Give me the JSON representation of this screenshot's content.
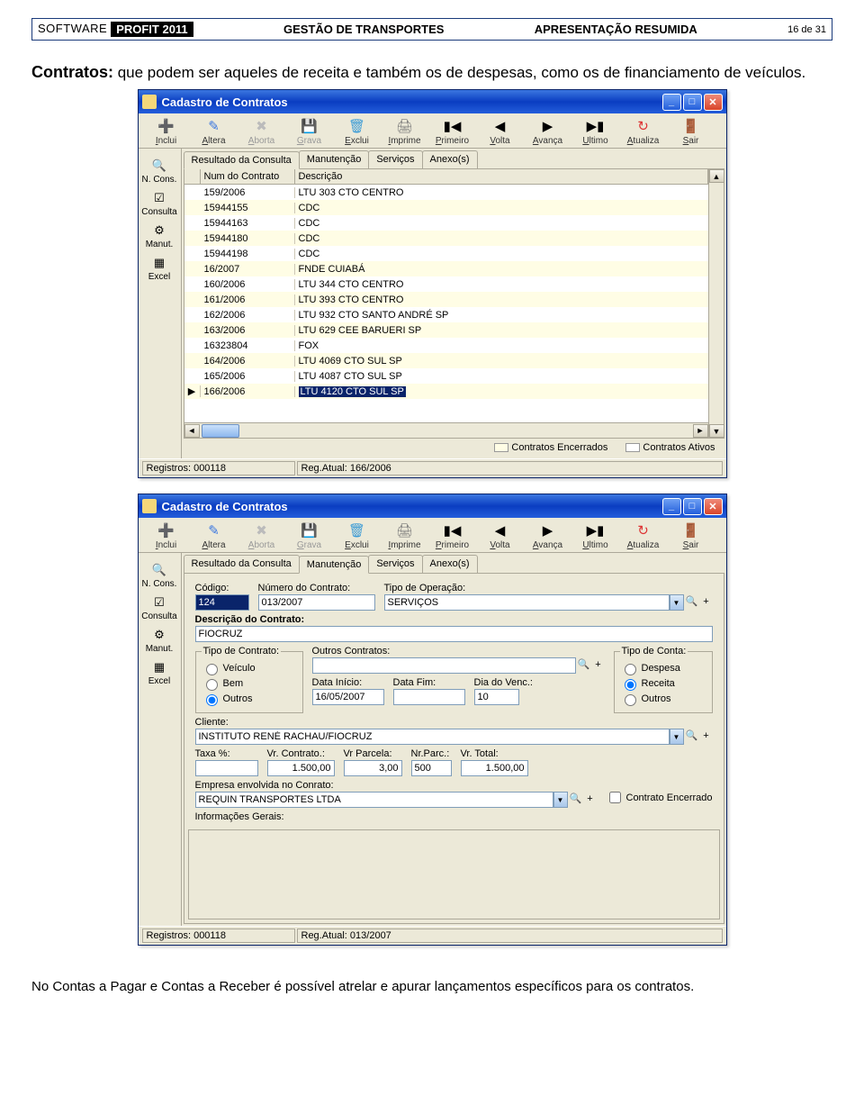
{
  "header": {
    "software": "SOFTWARE",
    "profit": "PROFIT 2011",
    "mid": "GESTÃO DE TRANSPORTES",
    "right": "APRESENTAÇÃO RESUMIDA",
    "page": "16 de 31"
  },
  "intro_bold": "Contratos:",
  "intro_text": " que podem ser aqueles de receita e também os de despesas, como os de financiamento de veículos.",
  "footer_text": "No Contas a Pagar e Contas a Receber é possível atrelar e apurar lançamentos específicos para os contratos.",
  "win": {
    "title": "Cadastro de Contratos",
    "toolbar": [
      {
        "label": "Inclui",
        "icon": "➕",
        "color": "#2a9d2a"
      },
      {
        "label": "Altera",
        "icon": "✎",
        "color": "#3b77e0"
      },
      {
        "label": "Aborta",
        "icon": "✖",
        "color": "#bbb",
        "dis": true
      },
      {
        "label": "Grava",
        "icon": "💾",
        "color": "#bbb",
        "dis": true
      },
      {
        "label": "Exclui",
        "icon": "🗑",
        "color": "#3b9bd6"
      },
      {
        "label": "Imprime",
        "icon": "🖨",
        "color": "#777"
      },
      {
        "label": "Primeiro",
        "icon": "▮◀",
        "color": "#000"
      },
      {
        "label": "Volta",
        "icon": "◀",
        "color": "#000"
      },
      {
        "label": "Avança",
        "icon": "▶",
        "color": "#000"
      },
      {
        "label": "Ultimo",
        "icon": "▶▮",
        "color": "#000"
      },
      {
        "label": "Atualiza",
        "icon": "↻",
        "color": "#d33"
      },
      {
        "label": "Sair",
        "icon": "🚪",
        "color": "#2a9d2a"
      }
    ],
    "sidebar": [
      {
        "label": "N. Cons.",
        "icon": "🔍"
      },
      {
        "label": "Consulta",
        "icon": "☑"
      },
      {
        "label": "Manut.",
        "icon": "⚙"
      },
      {
        "label": "Excel",
        "icon": "▦"
      }
    ],
    "tabs1": [
      "Resultado da Consulta",
      "Manutenção",
      "Serviços",
      "Anexo(s)"
    ],
    "grid": {
      "col1": "Num do Contrato",
      "col2": "Descrição",
      "rows": [
        {
          "n": "159/2006",
          "d": "LTU 303 CTO CENTRO"
        },
        {
          "n": "15944155",
          "d": "CDC"
        },
        {
          "n": "15944163",
          "d": "CDC"
        },
        {
          "n": "15944180",
          "d": "CDC"
        },
        {
          "n": "15944198",
          "d": "CDC"
        },
        {
          "n": "16/2007",
          "d": "FNDE CUIABÁ"
        },
        {
          "n": "160/2006",
          "d": "LTU 344 CTO CENTRO"
        },
        {
          "n": "161/2006",
          "d": "LTU 393 CTO CENTRO"
        },
        {
          "n": "162/2006",
          "d": "LTU 932 CTO SANTO ANDRÉ SP"
        },
        {
          "n": "163/2006",
          "d": "LTU 629 CEE BARUERI SP"
        },
        {
          "n": "16323804",
          "d": "FOX"
        },
        {
          "n": "164/2006",
          "d": "LTU 4069 CTO SUL SP"
        },
        {
          "n": "165/2006",
          "d": "LTU 4087 CTO SUL SP"
        },
        {
          "n": "166/2006",
          "d": "LTU 4120 CTO SUL SP"
        }
      ],
      "sel_index": 13
    },
    "legend": {
      "enc": "Contratos Encerrados",
      "ativ": "Contratos Ativos"
    },
    "status1": {
      "reg": "Registros: 000118",
      "atual": "Reg.Atual: 166/2006"
    }
  },
  "form": {
    "codigo_lbl": "Código:",
    "codigo": "124",
    "num_lbl": "Número do Contrato:",
    "num": "013/2007",
    "tipo_op_lbl": "Tipo de Operação:",
    "tipo_op": "SERVIÇOS",
    "desc_lbl": "Descrição do Contrato:",
    "desc": "FIOCRUZ",
    "tc_legend": "Tipo de Contrato:",
    "tc_opts": [
      "Veículo",
      "Bem",
      "Outros"
    ],
    "tc_sel": 2,
    "outros_lbl": "Outros Contratos:",
    "di_lbl": "Data Início:",
    "di": "16/05/2007",
    "df_lbl": "Data Fim:",
    "df": "",
    "dv_lbl": "Dia do Venc.:",
    "dv": "10",
    "tconta_legend": "Tipo de Conta:",
    "tconta_opts": [
      "Despesa",
      "Receita",
      "Outros"
    ],
    "tconta_sel": 1,
    "cli_lbl": "Cliente:",
    "cli": "INSTITUTO RENÉ RACHAU/FIOCRUZ",
    "taxa_lbl": "Taxa %:",
    "taxa": "",
    "vrc_lbl": "Vr. Contrato.:",
    "vrc": "1.500,00",
    "vrp_lbl": "Vr Parcela:",
    "vrp": "3,00",
    "np_lbl": "Nr.Parc.:",
    "np": "500",
    "vrt_lbl": "Vr. Total:",
    "vrt": "1.500,00",
    "emp_lbl": "Empresa envolvida no Conrato:",
    "emp": "REQUIN TRANSPORTES LTDA",
    "enc_chk": "Contrato Encerrado",
    "info_lbl": "Informações Gerais:",
    "status2": {
      "reg": "Registros: 000118",
      "atual": "Reg.Atual: 013/2007"
    }
  }
}
